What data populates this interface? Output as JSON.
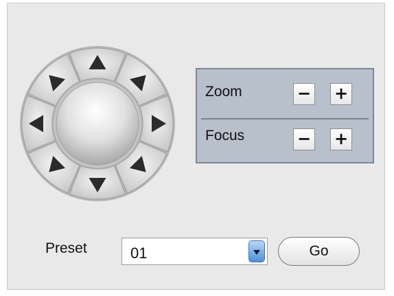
{
  "ptz": {
    "directions": [
      "up",
      "up-right",
      "right",
      "down-right",
      "down",
      "down-left",
      "left",
      "up-left"
    ]
  },
  "lens": {
    "zoom_label": "Zoom",
    "focus_label": "Focus",
    "minus_symbol": "−",
    "plus_symbol": "+"
  },
  "preset": {
    "label": "Preset",
    "selected": "01",
    "go_label": "Go"
  },
  "colors": {
    "panel_bg": "#e9e9e9",
    "lens_box_bg": "#b8c0cc",
    "select_arrow": "#4c8fd6"
  }
}
